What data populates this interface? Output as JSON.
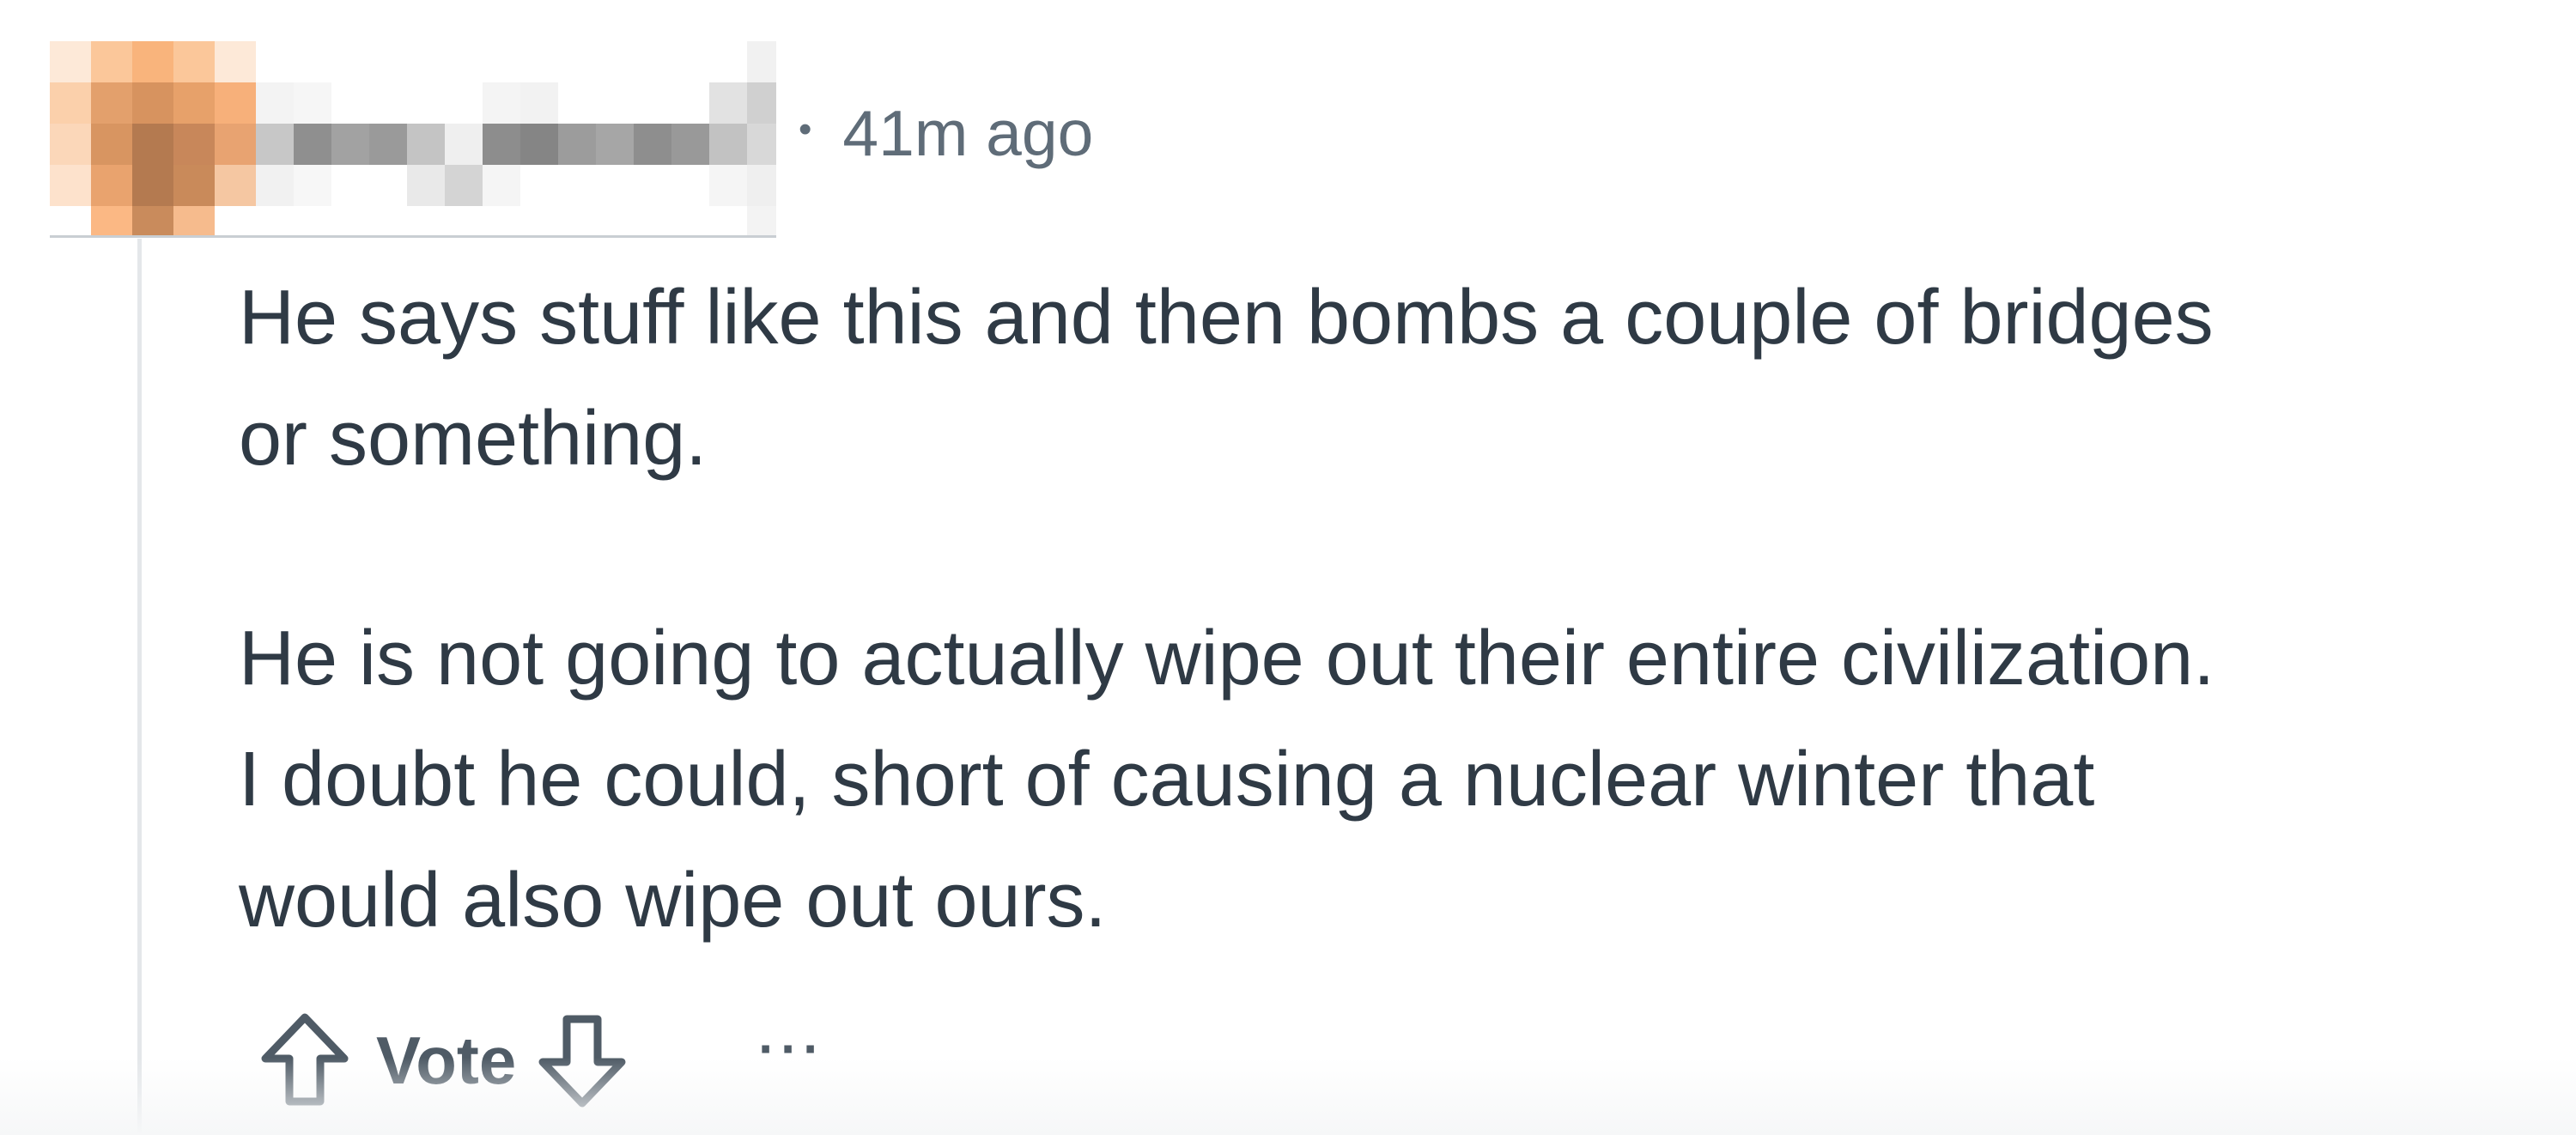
{
  "comment": {
    "author_display": "",
    "separator": "•",
    "timestamp": "41m ago",
    "paragraphs": [
      "He says stuff like this and then bombs a couple of bridges\nor something.",
      "He is not going to actually wipe out their entire civilization.\nI doubt he could, short of causing a nuclear winter that\nwould also wipe out ours."
    ]
  },
  "actions": {
    "upvote_icon": "arrow-up-outline-icon",
    "vote_label": "Vote",
    "downvote_icon": "arrow-down-outline-icon",
    "more_label": "···"
  },
  "colors": {
    "text": "#2f3a45",
    "meta": "#5f6c78",
    "icon": "#4f5b66",
    "thread_line": "#e4e7ea"
  }
}
